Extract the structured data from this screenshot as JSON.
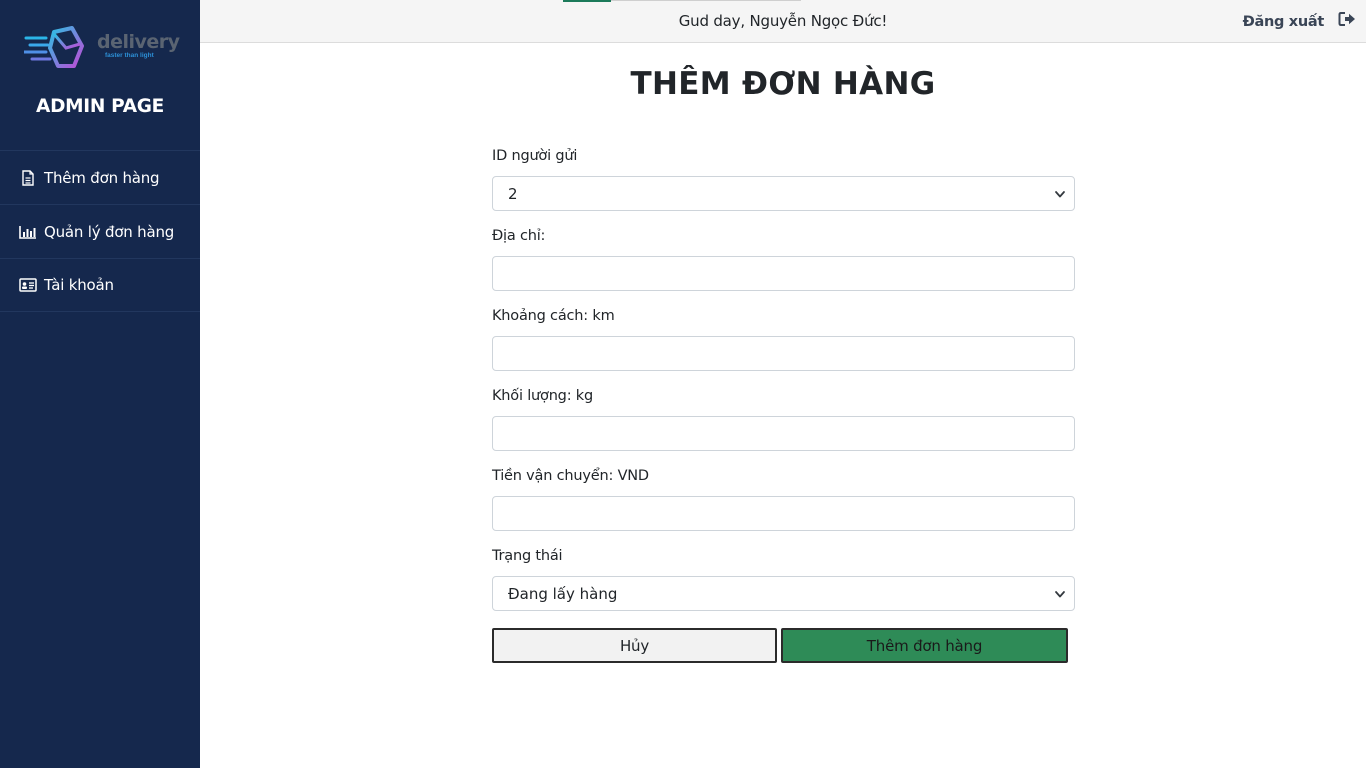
{
  "sidebar": {
    "logo": {
      "word": "delivery",
      "tagline": "faster than light"
    },
    "title": "ADMIN PAGE",
    "items": [
      {
        "label": "Thêm đơn hàng",
        "icon": "file-icon"
      },
      {
        "label": "Quản lý đơn hàng",
        "icon": "bar-chart-icon"
      },
      {
        "label": "Tài khoản",
        "icon": "id-card-icon"
      }
    ]
  },
  "header": {
    "greeting": "Gud day, Nguyễn Ngọc Đức!",
    "logout_label": "Đăng xuất",
    "logout_icon": "sign-out-icon"
  },
  "main": {
    "title": "THÊM ĐƠN HÀNG",
    "fields": {
      "sender": {
        "label": "ID người gửi",
        "value": "2"
      },
      "address": {
        "label": "Địa chỉ:",
        "value": ""
      },
      "distance": {
        "label": "Khoảng cách: km",
        "value": ""
      },
      "weight": {
        "label": "Khối lượng: kg",
        "value": ""
      },
      "fee": {
        "label": "Tiền vận chuyển: VND",
        "value": ""
      },
      "status": {
        "label": "Trạng thái",
        "value": "Đang lấy hàng"
      }
    },
    "buttons": {
      "cancel": "Hủy",
      "submit": "Thêm đơn hàng"
    }
  },
  "colors": {
    "sidebar_bg": "#15284d",
    "submit_bg": "#2e8b57",
    "topbar_bg": "#f5f5f5"
  }
}
